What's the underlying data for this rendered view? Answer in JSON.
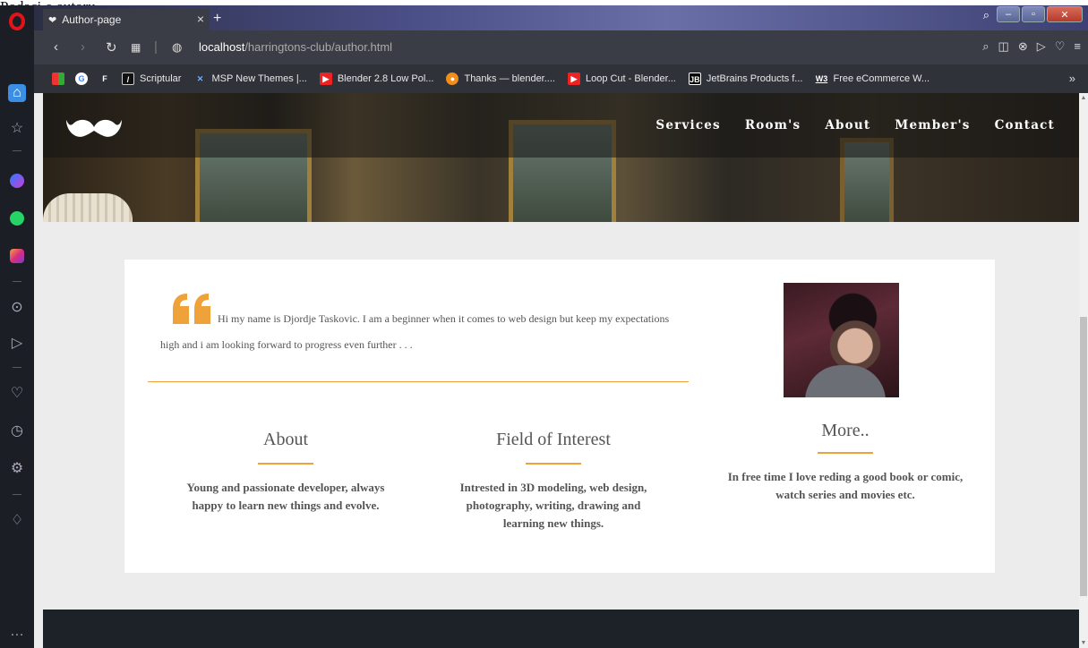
{
  "caption": "Podaci o autoru",
  "browser": {
    "tab_title": "Author-page",
    "url_host": "localhost",
    "url_path": "/harringtons-club/author.html",
    "bookmarks": [
      {
        "label": "Scriptular",
        "icon": "scriptular-icon"
      },
      {
        "label": "MSP New Themes |...",
        "icon": "msp-icon"
      },
      {
        "label": "Blender 2.8 Low Pol...",
        "icon": "youtube-icon"
      },
      {
        "label": "Thanks — blender....",
        "icon": "blender-icon"
      },
      {
        "label": "Loop Cut - Blender...",
        "icon": "youtube-icon"
      },
      {
        "label": "JetBrains Products f...",
        "icon": "jetbrains-icon"
      },
      {
        "label": "Free eCommerce W...",
        "icon": "w3schools-icon"
      }
    ]
  },
  "site": {
    "nav": [
      "Services",
      "Room's",
      "About",
      "Member's",
      "Contact"
    ]
  },
  "author": {
    "quote": "Hi my name is Djordje Taskovic. I am a beginner when it comes to web design but keep my expectations high and i am looking forward to progress even further . . .",
    "columns": [
      {
        "title": "About",
        "text": "Young and passionate developer, always happy to learn new things and evolve."
      },
      {
        "title": "Field of Interest",
        "text": "Intrested in 3D modeling, web design, photography, writing, drawing and learning new things."
      },
      {
        "title": "More..",
        "text": "In free time I love reding a good book or comic, watch series and movies etc."
      }
    ]
  },
  "colors": {
    "accent": "#f0a23a",
    "opera_red": "#e2131a",
    "page_bg": "#ececec",
    "footer_bg": "#1d2128"
  }
}
